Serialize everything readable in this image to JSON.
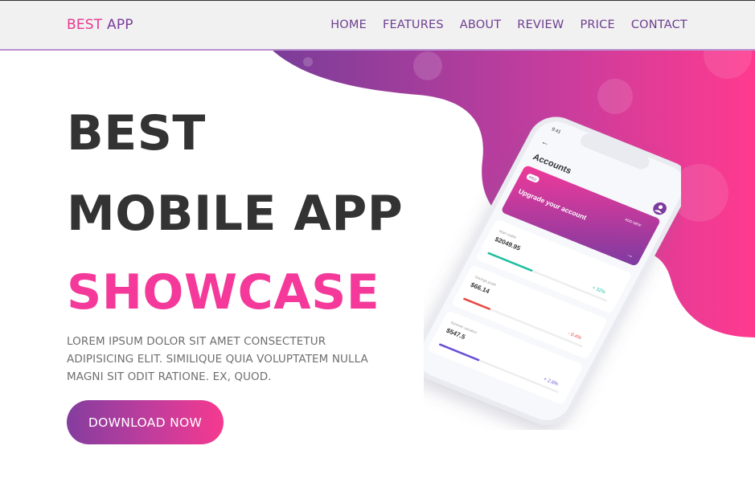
{
  "brand": {
    "part1": "BEST",
    "part2": "APP"
  },
  "nav": [
    {
      "label": "HOME"
    },
    {
      "label": "FEATURES"
    },
    {
      "label": "ABOUT"
    },
    {
      "label": "REVIEW"
    },
    {
      "label": "PRICE"
    },
    {
      "label": "CONTACT"
    }
  ],
  "hero": {
    "line1": "BEST",
    "line2": "MOBILE APP",
    "line3": "SHOWCASE",
    "description": "LOREM IPSUM DOLOR SIT AMET CONSECTETUR ADIPISICING ELIT. SIMILIQUE QUIA VOLUPTATEM NULLA MAGNI SIT ODIT RATIONE. EX, QUOD.",
    "cta_label": "DOWNLOAD NOW"
  },
  "phone": {
    "status_time": "9:41",
    "back_arrow": "←",
    "screen_title": "Accounts",
    "promo_pill": "PRO",
    "promo_text": "Upgrade your account",
    "promo_link": "ADD NEW",
    "accounts": [
      {
        "name": "Main wallet",
        "amount": "$2049.95",
        "change": "+ 32%",
        "bar_color": "#1fbfa0",
        "change_color": "#1fbfa0"
      },
      {
        "name": "Savings goals",
        "amount": "$66.14",
        "change": "- 0.4%",
        "bar_color": "#e8463f",
        "change_color": "#e8463f"
      },
      {
        "name": "Summer vacation",
        "amount": "$547.5",
        "change": "+ 2.6%",
        "bar_color": "#6a4fd6",
        "change_color": "#6a4fd6"
      }
    ]
  },
  "colors": {
    "accent_pink": "#f4399a",
    "accent_purple": "#7b3c9a",
    "title_dark": "#333333"
  }
}
